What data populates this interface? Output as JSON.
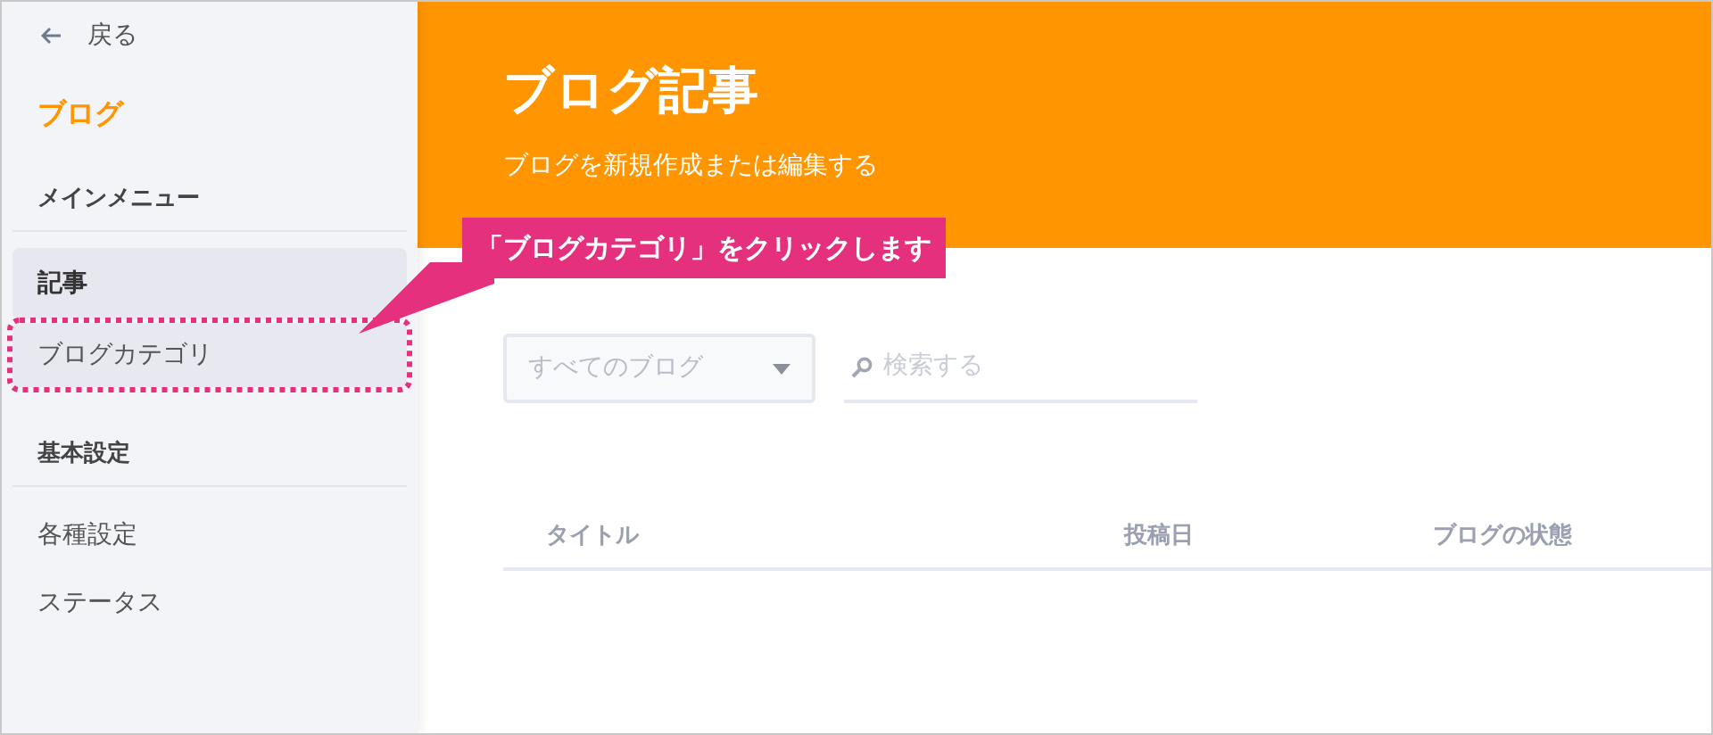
{
  "sidebar": {
    "back_link": "戻る",
    "title": "ブログ",
    "sections": [
      {
        "title": "メインメニュー",
        "items": [
          {
            "label": "記事",
            "selected": true,
            "highlighted": false
          },
          {
            "label": "ブログカテゴリ",
            "selected": false,
            "highlighted": true
          }
        ]
      },
      {
        "title": "基本設定",
        "items": [
          {
            "label": "各種設定",
            "selected": false,
            "highlighted": false
          },
          {
            "label": "ステータス",
            "selected": false,
            "highlighted": false
          }
        ]
      }
    ]
  },
  "header": {
    "title": "ブログ記事",
    "subtitle": "ブログを新規作成または編集する"
  },
  "callout": "「ブログカテゴリ」をクリックします",
  "filters": {
    "blog_select": "すべてのブログ",
    "search": {
      "placeholder": "検索する"
    }
  },
  "table": {
    "columns": [
      "タイトル",
      "投稿日",
      "ブログの状態"
    ]
  }
}
